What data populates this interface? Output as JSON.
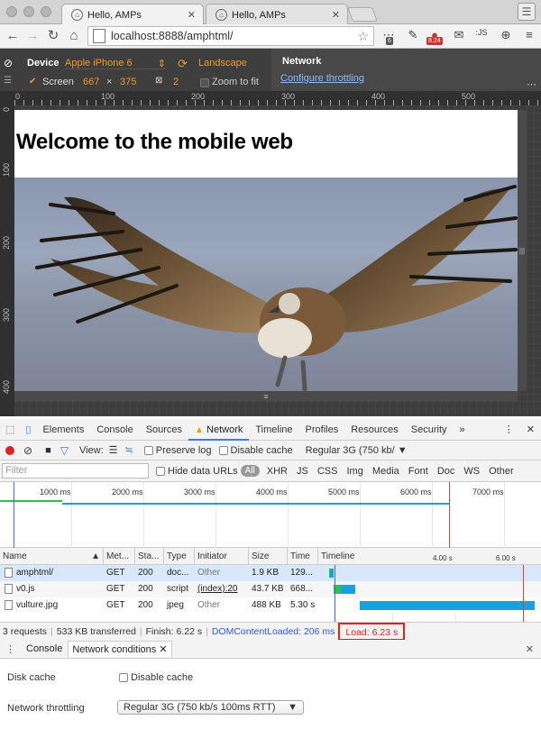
{
  "browser": {
    "tabs": [
      {
        "title": "Hello, AMPs"
      },
      {
        "title": "Hello, AMPs"
      }
    ],
    "url": "localhost:8888/amphtml/",
    "extension_badges": [
      "6",
      "8.24"
    ]
  },
  "device_toolbar": {
    "device_label": "Device",
    "device_value": "Apple iPhone 6",
    "orientation": "Landscape",
    "screen_label": "Screen",
    "width": "667",
    "times": "×",
    "height": "375",
    "dpr": "2",
    "zoom_label": "Zoom to fit",
    "network_title": "Network",
    "configure_link": "Configure throttling"
  },
  "rulers": {
    "top": [
      "0",
      "100",
      "200",
      "300",
      "400",
      "500"
    ],
    "left": [
      "0",
      "100",
      "200",
      "300",
      "400"
    ]
  },
  "page": {
    "heading": "Welcome to the mobile web"
  },
  "devtools": {
    "tabs": [
      "Elements",
      "Console",
      "Sources",
      "Network",
      "Timeline",
      "Profiles",
      "Resources",
      "Security"
    ],
    "more": "»",
    "view_label": "View:",
    "preserve_log": "Preserve log",
    "disable_cache": "Disable cache",
    "throttle_value": "Regular 3G (750 kb/",
    "filter_placeholder": "Filter",
    "hide_data_urls": "Hide data URLs",
    "all": "All",
    "types": [
      "XHR",
      "JS",
      "CSS",
      "Img",
      "Media",
      "Font",
      "Doc",
      "WS",
      "Other"
    ]
  },
  "overview": {
    "ticks": [
      "1000 ms",
      "2000 ms",
      "3000 ms",
      "4000 ms",
      "5000 ms",
      "6000 ms",
      "7000 ms"
    ]
  },
  "table": {
    "headers": [
      "Name",
      "Met...",
      "Sta...",
      "Type",
      "Initiator",
      "Size",
      "Time",
      "Timeline"
    ],
    "timeline_ticks": [
      "4.00 s",
      "6.00 s"
    ],
    "rows": [
      {
        "name": "amphtml/",
        "method": "GET",
        "status": "200",
        "type": "doc...",
        "initiator": "Other",
        "size": "1.9 KB",
        "time": "129...",
        "bar_start_s": 0.0,
        "bar_end_s": 0.13
      },
      {
        "name": "v0.js",
        "method": "GET",
        "status": "200",
        "type": "script",
        "initiator": "(index):20",
        "size": "43.7 KB",
        "time": "668...",
        "bar_start_s": 0.13,
        "bar_end_s": 0.8
      },
      {
        "name": "vulture.jpg",
        "method": "GET",
        "status": "200",
        "type": "jpeg",
        "initiator": "Other",
        "size": "488 KB",
        "time": "5.30 s",
        "bar_start_s": 0.92,
        "bar_end_s": 6.22
      }
    ]
  },
  "status_bar": {
    "requests": "3 requests",
    "transferred": "533 KB transferred",
    "finish": "Finish: 6.22 s",
    "dcl": "DOMContentLoaded: 206 ms",
    "load": "Load: 6.23 s"
  },
  "drawer": {
    "tabs": [
      "Console",
      "Network conditions"
    ],
    "disk_cache_label": "Disk cache",
    "disable_cache_label": "Disable cache",
    "throttling_label": "Network throttling",
    "throttling_value": "Regular 3G (750 kb/s 100ms RTT)"
  },
  "colors": {
    "accent_orange": "#f09b2a",
    "link_blue": "#3b7de0",
    "load_red": "#d22222",
    "bar_blue": "#1a9fe0",
    "bar_green": "#2bbd5a"
  }
}
